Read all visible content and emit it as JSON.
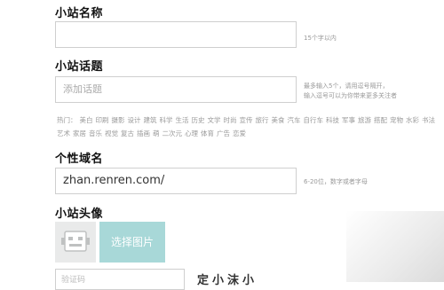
{
  "form": {
    "site_name": {
      "label": "小站名称",
      "value": "",
      "hint": "15个字以内"
    },
    "site_topic": {
      "label": "小站话题",
      "placeholder": "添加话题",
      "hint_line1": "最多输入5个，请用逗号隔开，",
      "hint_line2": "输入逗号可以为你带来更多关注者",
      "topics_prefix": "热门：",
      "topics": [
        "美白",
        "印刷",
        "摄影",
        "设计",
        "建筑",
        "科学",
        "生活",
        "历史",
        "文学",
        "时尚",
        "宣传",
        "旅行",
        "美食",
        "汽车",
        "自行车",
        "科技",
        "军事",
        "旅游",
        "搭配",
        "宠物",
        "水彩",
        "书法",
        "艺术",
        "家居",
        "音乐",
        "视觉",
        "复古",
        "插画",
        "萌",
        "二次元",
        "心理",
        "体育",
        "广告",
        "恋爱"
      ]
    },
    "domain": {
      "label": "个性域名",
      "value": "zhan.renren.com/",
      "hint": "6-20位，数字或者字母"
    },
    "avatar": {
      "label": "小站头像",
      "upload_label": "选择图片"
    },
    "captcha": {
      "placeholder": "验证码",
      "image_text": "定小沫小"
    }
  }
}
